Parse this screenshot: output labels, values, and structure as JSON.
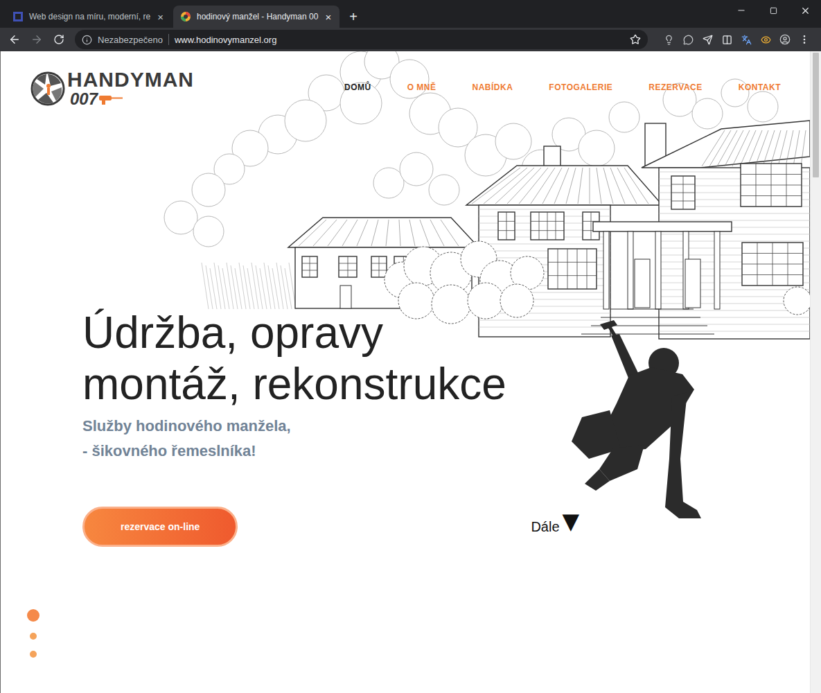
{
  "browser": {
    "tabs": [
      {
        "title": "Web design na míru, moderní, re",
        "selected": false
      },
      {
        "title": "hodinový manžel - Handyman 00",
        "selected": true
      }
    ],
    "tab_close": "×",
    "new_tab": "+",
    "navigation": {
      "back_enabled": true,
      "forward_enabled": false
    },
    "security": "Nezabezpečeno",
    "url": "www.hodinovymanzel.org"
  },
  "site": {
    "logo": {
      "name": "HANDYMAN",
      "number": "007"
    },
    "nav": [
      {
        "label": "DOMŮ",
        "selected": true
      },
      {
        "label": "O MNĚ",
        "selected": false
      },
      {
        "label": "NABÍDKA",
        "selected": false
      },
      {
        "label": "FOTOGALERIE",
        "selected": false
      },
      {
        "label": "REZERVACE",
        "selected": false
      },
      {
        "label": "KONTAKT",
        "selected": false
      }
    ],
    "hero": {
      "heading": [
        "Údržba, opravy",
        "montáž, rekonstrukce"
      ],
      "subtitle": [
        "Služby hodinového manžela,",
        "- šikovného řemeslníka!"
      ],
      "button": "rezervace on-line",
      "scroll_hint": {
        "label": "Dále",
        "arrow": "▼"
      }
    },
    "slides": [
      {
        "selected": true
      },
      {
        "selected": false
      },
      {
        "selected": false
      }
    ]
  }
}
